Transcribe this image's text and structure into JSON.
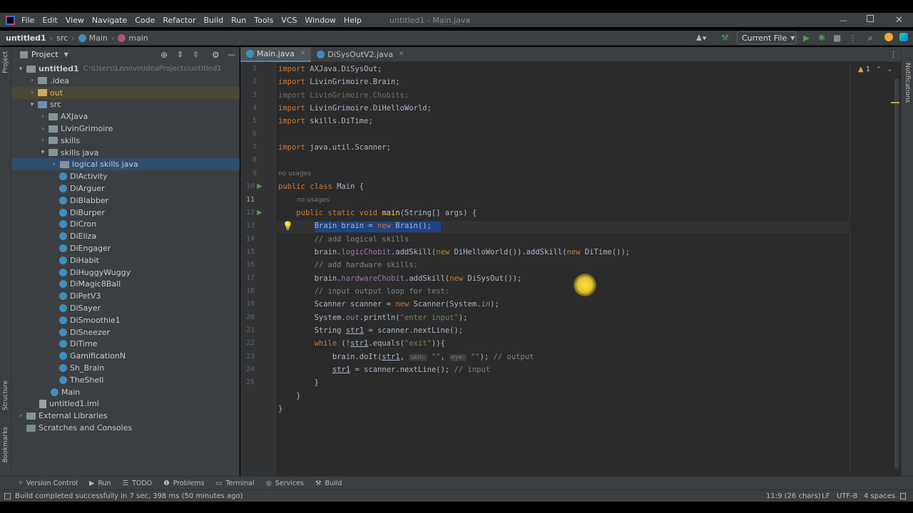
{
  "window": {
    "title": "untitled1 - Main.java",
    "menu": [
      "File",
      "Edit",
      "View",
      "Navigate",
      "Code",
      "Refactor",
      "Build",
      "Run",
      "Tools",
      "VCS",
      "Window",
      "Help"
    ]
  },
  "breadcrumb": {
    "project": "untitled1",
    "folder": "src",
    "class": "Main",
    "method": "main",
    "run_config": "Current File"
  },
  "project_panel": {
    "title": "Project",
    "root_name": "untitled1",
    "root_path": "C:\\Users\\Lenovo\\IdeaProjects\\untitled1",
    "items": [
      {
        "label": "untitled1",
        "depth": 0,
        "kind": "folder",
        "arrow": "▾"
      },
      {
        "label": ".idea",
        "depth": 1,
        "kind": "folder",
        "arrow": "›"
      },
      {
        "label": "out",
        "depth": 1,
        "kind": "folder-orange",
        "arrow": "›"
      },
      {
        "label": "src",
        "depth": 1,
        "kind": "folder-blue",
        "arrow": "▾"
      },
      {
        "label": "AXJava",
        "depth": 2,
        "kind": "folder",
        "arrow": "›"
      },
      {
        "label": "LivinGrimoire",
        "depth": 2,
        "kind": "folder",
        "arrow": "›"
      },
      {
        "label": "skills",
        "depth": 2,
        "kind": "folder",
        "arrow": "›"
      },
      {
        "label": "skills java",
        "depth": 2,
        "kind": "folder",
        "arrow": "▾"
      },
      {
        "label": "logical skills java",
        "depth": 3,
        "kind": "folder",
        "arrow": "›"
      },
      {
        "label": "DiActivity",
        "depth": 4,
        "kind": "class",
        "arrow": ""
      },
      {
        "label": "DiArguer",
        "depth": 4,
        "kind": "class",
        "arrow": ""
      },
      {
        "label": "DiBlabber",
        "depth": 4,
        "kind": "class",
        "arrow": ""
      },
      {
        "label": "DiBurper",
        "depth": 4,
        "kind": "class",
        "arrow": ""
      },
      {
        "label": "DiCron",
        "depth": 4,
        "kind": "class",
        "arrow": ""
      },
      {
        "label": "DiEliza",
        "depth": 4,
        "kind": "class",
        "arrow": ""
      },
      {
        "label": "DiEngager",
        "depth": 4,
        "kind": "class",
        "arrow": ""
      },
      {
        "label": "DiHabit",
        "depth": 4,
        "kind": "class",
        "arrow": ""
      },
      {
        "label": "DiHuggyWuggy",
        "depth": 4,
        "kind": "class",
        "arrow": ""
      },
      {
        "label": "DiMagic8Ball",
        "depth": 4,
        "kind": "class",
        "arrow": ""
      },
      {
        "label": "DiPetV3",
        "depth": 4,
        "kind": "class",
        "arrow": ""
      },
      {
        "label": "DiSayer",
        "depth": 4,
        "kind": "class",
        "arrow": ""
      },
      {
        "label": "DiSmoothie1",
        "depth": 4,
        "kind": "class",
        "arrow": ""
      },
      {
        "label": "DiSneezer",
        "depth": 4,
        "kind": "class",
        "arrow": ""
      },
      {
        "label": "DiTime",
        "depth": 4,
        "kind": "class",
        "arrow": ""
      },
      {
        "label": "GamificationN",
        "depth": 4,
        "kind": "class",
        "arrow": ""
      },
      {
        "label": "Sh_Brain",
        "depth": 4,
        "kind": "class",
        "arrow": ""
      },
      {
        "label": "TheShell",
        "depth": 4,
        "kind": "class",
        "arrow": ""
      },
      {
        "label": "Main",
        "depth": 3,
        "kind": "class",
        "arrow": ""
      },
      {
        "label": "untitled1.iml",
        "depth": 2,
        "kind": "file",
        "arrow": ""
      },
      {
        "label": "External Libraries",
        "depth": 0,
        "kind": "lib",
        "arrow": "›"
      },
      {
        "label": "Scratches and Consoles",
        "depth": 0,
        "kind": "scratch",
        "arrow": ""
      }
    ]
  },
  "tabs": [
    {
      "label": "Main.java",
      "active": true
    },
    {
      "label": "DiSysOutV2.java",
      "active": false
    }
  ],
  "editor": {
    "inspection_count": "1",
    "usage_hint": "no usages",
    "hint_skin": "skin:",
    "hint_eye": "eye:"
  },
  "tool_windows": [
    "Version Control",
    "Run",
    "TODO",
    "Problems",
    "Terminal",
    "Services",
    "Build"
  ],
  "side_labels": {
    "project": "Project",
    "structure": "Structure",
    "bookmarks": "Bookmarks",
    "notifications": "Notifications"
  },
  "status": {
    "message": "Build completed successfully in 7 sec, 398 ms (50 minutes ago)",
    "position": "11:9 (26 chars)",
    "line_sep": "LF",
    "encoding": "UTF-8",
    "indent": "4 spaces"
  },
  "colors": {
    "accent": "#4a88c7",
    "selection": "#214283",
    "run_green": "#499c54"
  }
}
